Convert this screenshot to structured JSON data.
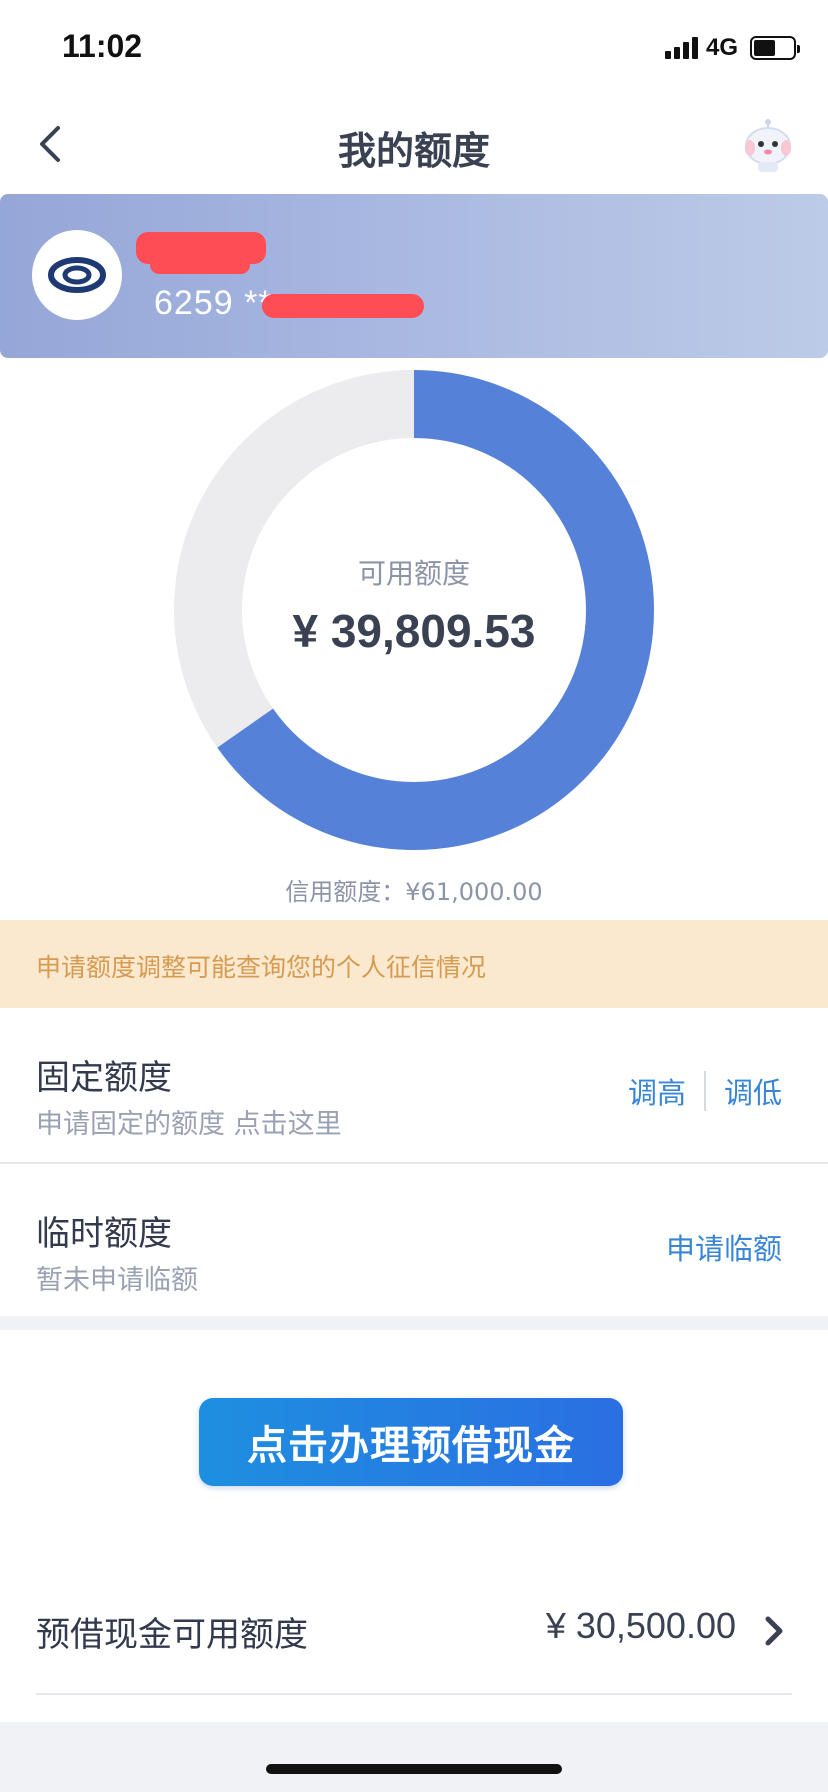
{
  "status_bar": {
    "time": "11:02",
    "network": "4G",
    "signal_bars": 4,
    "battery_level": 0.55
  },
  "nav": {
    "title": "我的额度",
    "back_icon": "chevron-left-icon",
    "avatar_icon": "robot-assistant-icon"
  },
  "card": {
    "holder_name": "",
    "number_prefix": "6259 **",
    "bank_logo_icon": "bank-logo-icon"
  },
  "credit": {
    "available_label": "可用额度",
    "available_amount": "¥ 39,809.53",
    "credit_limit_text": "信用额度：¥61,000.00",
    "available_value": 39809.53,
    "limit_value": 61000.0,
    "colors": {
      "used": "#ececef",
      "available": "#5681d8"
    }
  },
  "notice": {
    "text": "申请额度调整可能查询您的个人征信情况"
  },
  "fixed_limit": {
    "title": "固定额度",
    "subtitle": "申请固定的额度 点击这里",
    "increase_label": "调高",
    "decrease_label": "调低"
  },
  "temp_limit": {
    "title": "临时额度",
    "subtitle": "暂未申请临额",
    "apply_label": "申请临额"
  },
  "promo": {
    "button_label": "点击办理预借现金"
  },
  "cash_advance": {
    "label": "预借现金可用额度",
    "amount": "¥ 30,500.00"
  }
}
